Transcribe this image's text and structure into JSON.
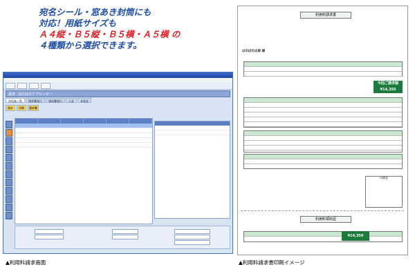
{
  "promo": {
    "line1": "宛名シール・窓あき封筒にも",
    "line2": "対応！用紙サイズも",
    "line3": "Ａ４縦・Ｂ５縦・Ｂ５横・Ａ５横 の",
    "line4": "４種類から選択できます。"
  },
  "screen": {
    "title": "請求",
    "office": "ほのぼのケアセンター",
    "tabs": [
      "利用者一覧",
      "請求書発行",
      "領収書発行",
      "入金",
      "未収金"
    ],
    "side_buttons": [
      "保存",
      "印刷",
      "請求書"
    ]
  },
  "invoice": {
    "title": "利用料請求書",
    "recipient": "ほのぼの太郎 様",
    "amount_label": "今回ご請求額",
    "amount_value": "¥14,350",
    "receipt_title": "利用料領収証",
    "receipt_amount": "¥14,350",
    "calendar_title": "CR判日"
  },
  "captions": {
    "left": "▲利用料請求画面",
    "right": "▲利用料請求書印刷イメージ"
  },
  "colors": {
    "promo_blue": "#1f4fa8",
    "promo_red": "#e0252a",
    "window_blue": "#3b67c7",
    "invoice_green": "#1b7a3c"
  }
}
